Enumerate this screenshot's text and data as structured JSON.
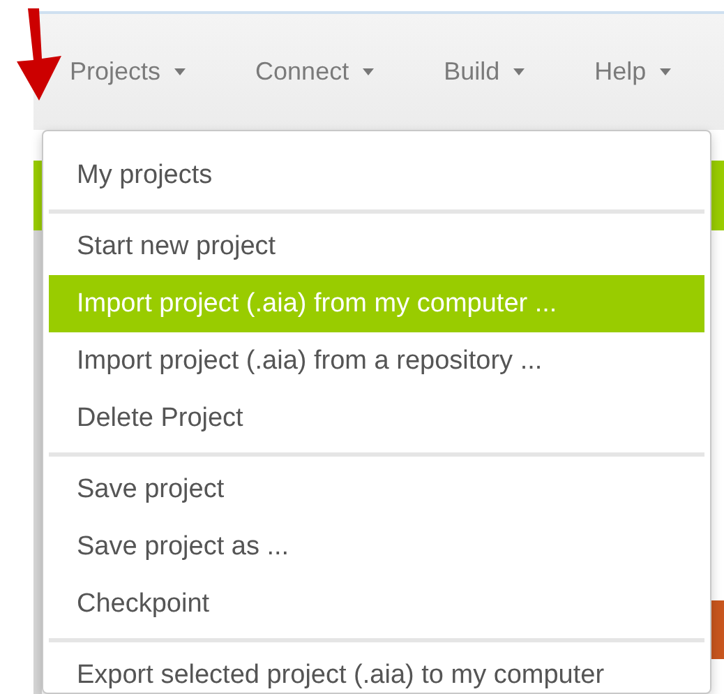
{
  "navbar": {
    "menus": [
      {
        "label": "Projects"
      },
      {
        "label": "Connect"
      },
      {
        "label": "Build"
      },
      {
        "label": "Help"
      }
    ]
  },
  "dropdown": {
    "items": [
      {
        "kind": "item",
        "label": "My projects",
        "selected": false
      },
      {
        "kind": "divider"
      },
      {
        "kind": "item",
        "label": "Start new project",
        "selected": false
      },
      {
        "kind": "item",
        "label": "Import project (.aia) from my computer ...",
        "selected": true
      },
      {
        "kind": "item",
        "label": "Import project (.aia) from a repository ...",
        "selected": false
      },
      {
        "kind": "item",
        "label": "Delete Project",
        "selected": false
      },
      {
        "kind": "divider"
      },
      {
        "kind": "item",
        "label": "Save project",
        "selected": false
      },
      {
        "kind": "item",
        "label": "Save project as ...",
        "selected": false
      },
      {
        "kind": "item",
        "label": "Checkpoint",
        "selected": false
      },
      {
        "kind": "divider"
      },
      {
        "kind": "item",
        "label": "Export selected project (.aia) to my computer",
        "selected": false
      }
    ]
  }
}
